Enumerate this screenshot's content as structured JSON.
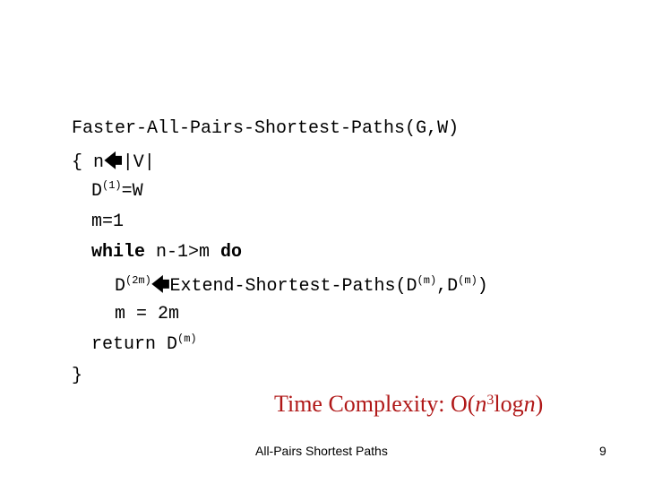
{
  "slide": {
    "algorithm": {
      "title": "Faster-All-Pairs-Shortest-Paths(G,W)",
      "line1_open": "{ n",
      "line1_rest": "|V|",
      "line2_D": "D",
      "line2_sup": "(1)",
      "line2_rest": "=W",
      "line3": "m=1",
      "line4_while": "while",
      "line4_cond": " n-1>m ",
      "line4_do": "do",
      "line5_D": "D",
      "line5_sup": "(2m)",
      "line5_call": "Extend-Shortest-Paths(D",
      "line5_sup2": "(m)",
      "line5_mid": ",D",
      "line5_sup3": "(m)",
      "line5_close": ")",
      "line6": "m = 2m",
      "line7_return": "return D",
      "line7_sup": "(m)",
      "line8": "}"
    },
    "arrow_icon": "left-arrow-icon",
    "arrow_glyph": "🡄",
    "complexity": {
      "prefix": "Time Complexity: O(",
      "n1": "n",
      "exp": "3",
      "log": "log",
      "n2": "n",
      "suffix": ")",
      "color": "#b01818"
    },
    "footer": {
      "title": "All-Pairs Shortest Paths",
      "page_number": "9"
    }
  }
}
